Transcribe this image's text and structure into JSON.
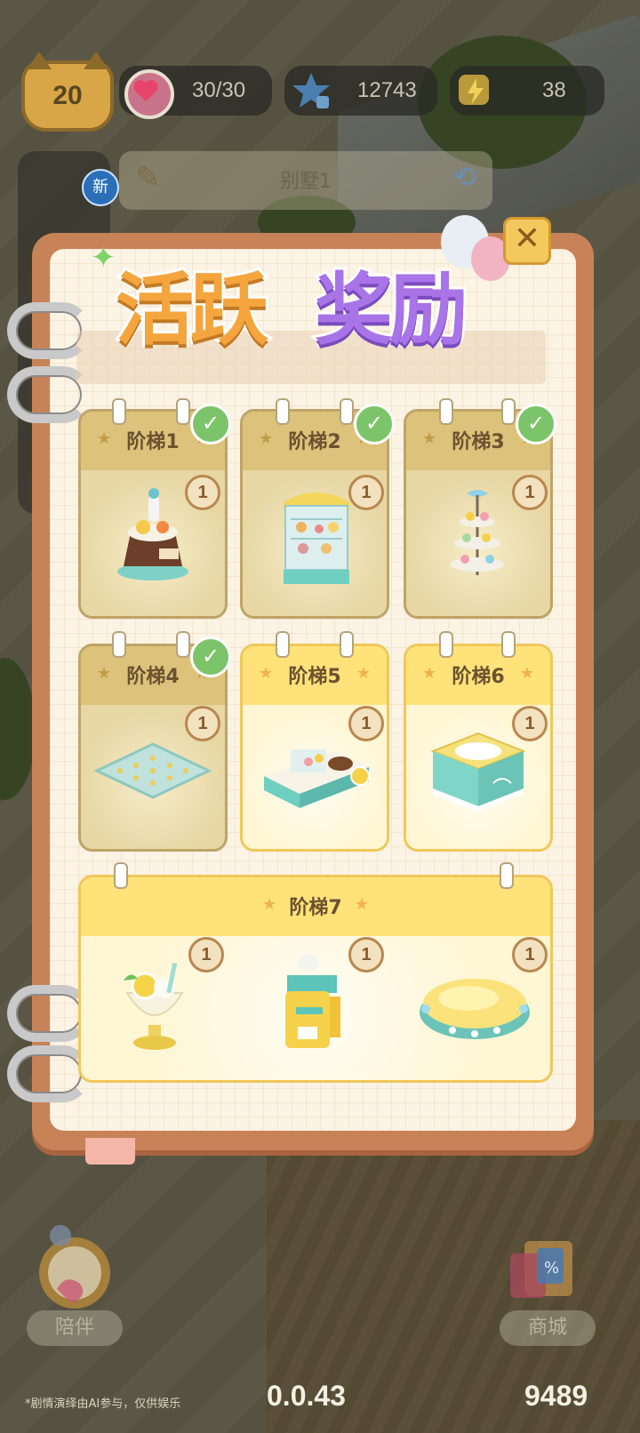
{
  "hud": {
    "level": "20",
    "hearts": "30/30",
    "stars": "12743",
    "energy": "38"
  },
  "room": {
    "name": "别墅1",
    "new_badge": "新"
  },
  "modal": {
    "title_part1": "活跃",
    "title_part2": "奖励",
    "close_label": "✕"
  },
  "tiers": [
    {
      "label": "阶梯1",
      "qty": "1",
      "claimed": true,
      "item": "cake-icon"
    },
    {
      "label": "阶梯2",
      "qty": "1",
      "claimed": true,
      "item": "display-cabinet-icon"
    },
    {
      "label": "阶梯3",
      "qty": "1",
      "claimed": true,
      "item": "dessert-stand-icon"
    },
    {
      "label": "阶梯4",
      "qty": "1",
      "claimed": true,
      "item": "rug-icon"
    },
    {
      "label": "阶梯5",
      "qty": "1",
      "claimed": false,
      "item": "dessert-counter-icon"
    },
    {
      "label": "阶梯6",
      "qty": "1",
      "claimed": false,
      "item": "cake-table-icon"
    },
    {
      "label": "阶梯7",
      "qty": [
        "1",
        "1",
        "1"
      ],
      "claimed": false,
      "items": [
        "lemon-sundae-icon",
        "coffee-machine-icon",
        "cushion-bed-icon"
      ]
    }
  ],
  "bottom": {
    "companion_label": "陪伴",
    "shop_label": "商城",
    "disclaimer": "*剧情演绎由AI参与，仅供娱乐",
    "version": "0.0.43",
    "gold": "9489"
  },
  "colors": {
    "title_orange": "#f5a53d",
    "title_purple": "#a874e8",
    "check_green": "#7cc46a",
    "book_brown": "#c88257"
  }
}
